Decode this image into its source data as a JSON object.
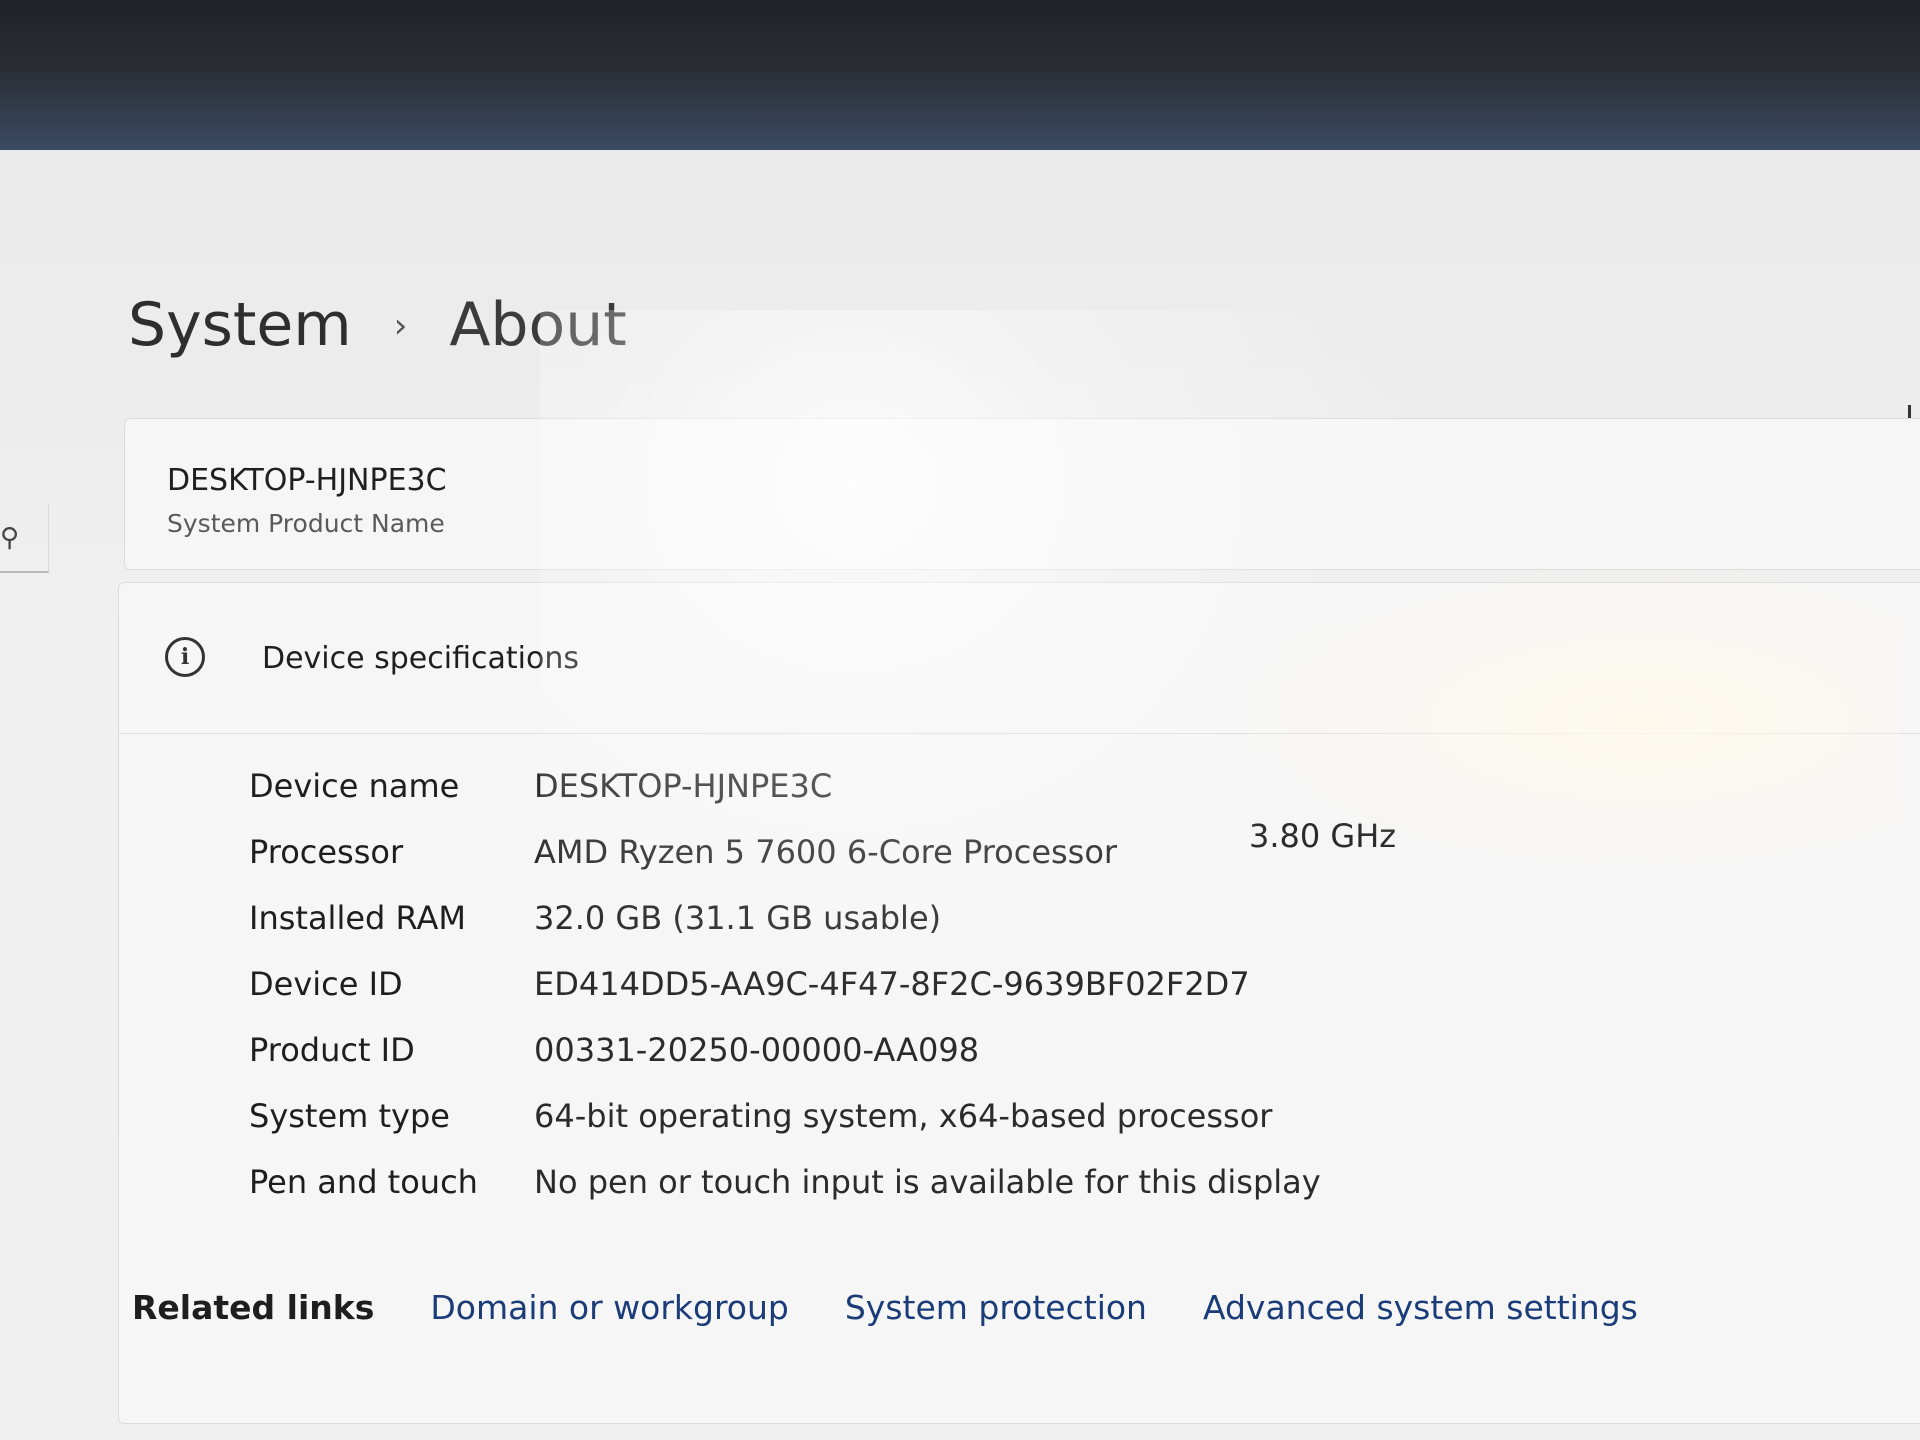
{
  "breadcrumb": {
    "parent": "System",
    "separator": "›",
    "current": "About"
  },
  "product": {
    "hostname": "DESKTOP-HJNPE3C",
    "subtitle": "System Product Name"
  },
  "device_specs": {
    "title": "Device specifications",
    "rows": [
      {
        "label": "Device name",
        "value": "DESKTOP-HJNPE3C"
      },
      {
        "label": "Processor",
        "value": "AMD Ryzen 5 7600 6-Core Processor",
        "extra": "3.80 GHz"
      },
      {
        "label": "Installed RAM",
        "value": "32.0 GB (31.1 GB usable)"
      },
      {
        "label": "Device ID",
        "value": "ED414DD5-AA9C-4F47-8F2C-9639BF02F2D7"
      },
      {
        "label": "Product ID",
        "value": "00331-20250-00000-AA098"
      },
      {
        "label": "System type",
        "value": "64-bit operating system, x64-based processor"
      },
      {
        "label": "Pen and touch",
        "value": "No pen or touch input is available for this display"
      }
    ]
  },
  "related_links": {
    "label": "Related links",
    "links": [
      "Domain or workgroup",
      "System protection",
      "Advanced system settings"
    ]
  },
  "colors": {
    "link": "#1a3c78",
    "background": "#f0f0f0"
  },
  "icons": {
    "info": "info-circle-icon",
    "search": "search-icon"
  }
}
